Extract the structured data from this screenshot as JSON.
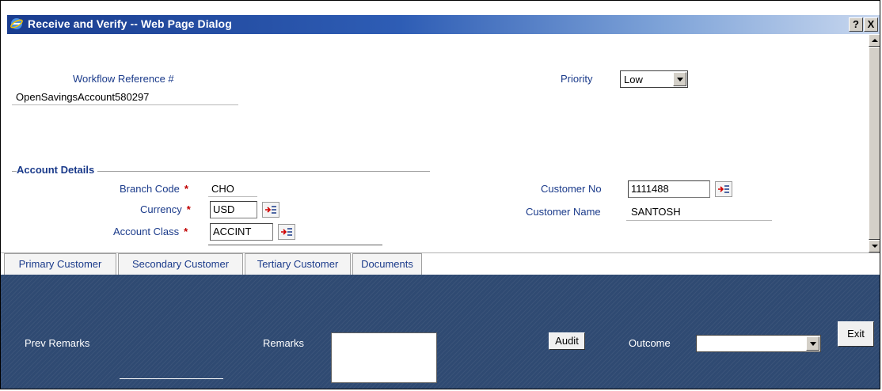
{
  "window": {
    "title": "Receive and Verify -- Web Page Dialog",
    "help_label": "?",
    "close_label": "X"
  },
  "workflow": {
    "reference_label": "Workflow Reference #",
    "reference_value": "OpenSavingsAccount580297",
    "priority_label": "Priority",
    "priority_value": "Low"
  },
  "account_details": {
    "section_title": "Account Details",
    "branch_code_label": "Branch Code",
    "branch_code_value": "CHO",
    "currency_label": "Currency",
    "currency_value": "USD",
    "account_class_label": "Account Class",
    "account_class_value": "ACCINT",
    "customer_no_label": "Customer No",
    "customer_no_value": "1111488",
    "customer_name_label": "Customer Name",
    "customer_name_value": "SANTOSH",
    "required_mark": "*"
  },
  "tabs": [
    {
      "label": "Primary Customer"
    },
    {
      "label": "Secondary Customer"
    },
    {
      "label": "Tertiary Customer"
    },
    {
      "label": "Documents"
    }
  ],
  "footer": {
    "prev_remarks_label": "Prev Remarks",
    "remarks_label": "Remarks",
    "remarks_value": "",
    "audit_label": "Audit",
    "outcome_label": "Outcome",
    "outcome_value": "",
    "exit_label": "Exit"
  },
  "colors": {
    "title_bar": "#1a3d8f",
    "label_text": "#1a3a8a",
    "footer_bg": "#2f4a72",
    "required": "#c00000"
  }
}
